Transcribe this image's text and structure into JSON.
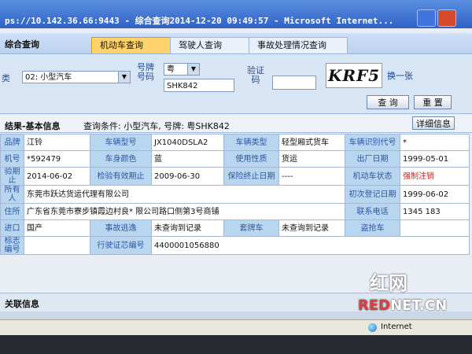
{
  "window": {
    "title": "ps://10.142.36.66:9443 - 综合查询2014-12-20 09:49:57 - Microsoft Internet..."
  },
  "tabs": {
    "home_label": "综合查询",
    "items": [
      {
        "label": "机动车查询",
        "active": true
      },
      {
        "label": "驾驶人查询",
        "active": false
      },
      {
        "label": "事故处理情况查询",
        "active": false
      }
    ]
  },
  "query_form": {
    "vehicle_type_label": "类",
    "vehicle_type_value": "02: 小型汽车",
    "plate_label": "号牌号码",
    "plate_prefix_value": "粤",
    "plate_number_value": "SHK842",
    "captcha_label": "验证码",
    "captcha_input_value": "",
    "captcha_text": "KRF5",
    "refresh_link": "换一张",
    "query_button": "查 询",
    "reset_button": "重 置"
  },
  "result": {
    "title": "结果-基本信息",
    "condition": "查询条件: 小型汽车, 号牌: 粤SHK842",
    "detail_button": "详细信息",
    "rows": [
      [
        "品牌",
        "江铃",
        "车辆型号",
        "JX1040DSLA2",
        "车辆类型",
        "轻型厢式货车",
        "车辆识别代号",
        "*"
      ],
      [
        "机号",
        "*592479",
        "车身颜色",
        "蓝",
        "使用性质",
        "货运",
        "出厂日期",
        "1999-05-01"
      ],
      [
        "验期止",
        "2014-06-02",
        "检验有效期止",
        "2009-06-30",
        "保险终止日期",
        "----",
        "机动车状态",
        "强制注销"
      ],
      [
        "所有人",
        "东莞市跃达货运代理有限公司",
        "初次登记日期",
        "1999-06-02"
      ],
      [
        "住所",
        "广东省东莞市寮步镇霞边村良*              限公司路口侧第3号商铺",
        "联系电话",
        "1345      183"
      ],
      [
        "进口",
        "国产",
        "事故逃逸",
        "未查询到记录",
        "套牌车",
        "未查询到记录",
        "盗抢车",
        ""
      ],
      [
        "标志编号",
        "",
        "行驶证芯编号",
        "4400001056880"
      ]
    ]
  },
  "related": {
    "title": "关联信息"
  },
  "statusbar": {
    "zone": "Internet"
  },
  "watermark": {
    "line1": "红网",
    "line2_red": "RED",
    "line2_rest": "NET.CN"
  }
}
